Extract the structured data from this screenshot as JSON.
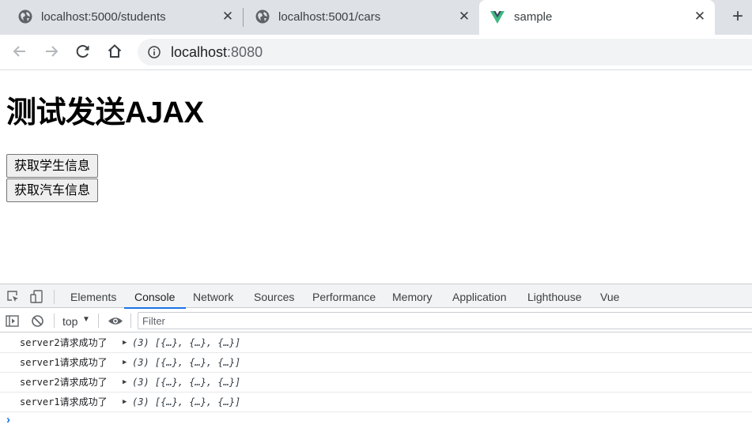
{
  "browser": {
    "tabs": [
      {
        "title": "localhost:5000/students",
        "icon": "globe-icon",
        "active": false
      },
      {
        "title": "localhost:5001/cars",
        "icon": "globe-icon",
        "active": false
      },
      {
        "title": "sample",
        "icon": "vue-logo-icon",
        "active": true
      }
    ],
    "close_glyph": "✕",
    "new_tab_glyph": "+",
    "address": {
      "host": "localhost",
      "port": ":8080"
    }
  },
  "page": {
    "title": "测试发送AJAX",
    "buttons": [
      {
        "label": "获取学生信息"
      },
      {
        "label": "获取汽车信息"
      }
    ]
  },
  "devtools": {
    "tabs": [
      "Elements",
      "Console",
      "Network",
      "Sources",
      "Performance",
      "Memory",
      "Application",
      "Lighthouse",
      "Vue"
    ],
    "active_tab": "Console",
    "context": "top",
    "filter_placeholder": "Filter",
    "logs": [
      {
        "message": "server2请求成功了",
        "value": "(3) [{…}, {…}, {…}]"
      },
      {
        "message": "server1请求成功了",
        "value": "(3) [{…}, {…}, {…}]"
      },
      {
        "message": "server2请求成功了",
        "value": "(3) [{…}, {…}, {…}]"
      },
      {
        "message": "server1请求成功了",
        "value": "(3) [{…}, {…}, {…}]"
      }
    ],
    "prompt_glyph": "›"
  },
  "colors": {
    "tabstrip_bg": "#dee1e6",
    "accent": "#1a73e8",
    "vue_green": "#41b883",
    "vue_dark": "#35495e"
  }
}
